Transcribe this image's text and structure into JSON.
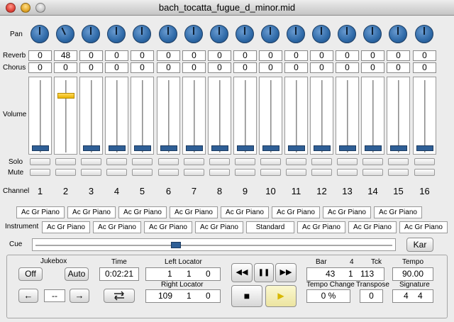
{
  "window": {
    "title": "bach_tocatta_fugue_d_minor.mid"
  },
  "labels": {
    "pan": "Pan",
    "reverb": "Reverb",
    "chorus": "Chorus",
    "volume": "Volume",
    "solo": "Solo",
    "mute": "Mute",
    "channel": "Channel",
    "instrument": "Instrument",
    "cue": "Cue"
  },
  "channels": [
    {
      "num": "1",
      "reverb": "0",
      "chorus": "0"
    },
    {
      "num": "2",
      "reverb": "48",
      "chorus": "0"
    },
    {
      "num": "3",
      "reverb": "0",
      "chorus": "0"
    },
    {
      "num": "4",
      "reverb": "0",
      "chorus": "0"
    },
    {
      "num": "5",
      "reverb": "0",
      "chorus": "0"
    },
    {
      "num": "6",
      "reverb": "0",
      "chorus": "0"
    },
    {
      "num": "7",
      "reverb": "0",
      "chorus": "0"
    },
    {
      "num": "8",
      "reverb": "0",
      "chorus": "0"
    },
    {
      "num": "9",
      "reverb": "0",
      "chorus": "0"
    },
    {
      "num": "10",
      "reverb": "0",
      "chorus": "0"
    },
    {
      "num": "11",
      "reverb": "0",
      "chorus": "0"
    },
    {
      "num": "12",
      "reverb": "0",
      "chorus": "0"
    },
    {
      "num": "13",
      "reverb": "0",
      "chorus": "0"
    },
    {
      "num": "14",
      "reverb": "0",
      "chorus": "0"
    },
    {
      "num": "15",
      "reverb": "0",
      "chorus": "0"
    },
    {
      "num": "16",
      "reverb": "0",
      "chorus": "0"
    }
  ],
  "instruments": {
    "row1": [
      "Ac Gr Piano",
      "Ac Gr Piano",
      "Ac Gr Piano",
      "Ac Gr Piano",
      "Ac Gr Piano",
      "Ac Gr Piano",
      "Ac Gr Piano",
      "Ac Gr Piano"
    ],
    "row2": [
      "Ac Gr Piano",
      "Ac Gr Piano",
      "Ac Gr Piano",
      "Ac Gr Piano",
      "Standard",
      "Ac Gr Piano",
      "Ac Gr Piano",
      "Ac Gr Piano"
    ]
  },
  "cue_button": "Kar",
  "jukebox": {
    "title": "Jukebox",
    "off": "Off",
    "auto": "Auto",
    "prev": "←",
    "next": "→",
    "current": "--"
  },
  "time": {
    "label": "Time",
    "value": "0:02:21"
  },
  "left_locator": {
    "label": "Left Locator",
    "bar": "1",
    "beat": "1",
    "tick": "0"
  },
  "right_locator": {
    "label": "Right Locator",
    "bar": "109",
    "beat": "1",
    "tick": "0"
  },
  "transport": {
    "rewind": "◀◀",
    "pause": "❚❚",
    "forward": "▶▶",
    "stop": "■",
    "play": "▶"
  },
  "position": {
    "bar_label": "Bar",
    "beat_label": "4",
    "tck_label": "Tck",
    "bar": "43",
    "beat": "1",
    "tick": "113"
  },
  "tempo": {
    "label": "Tempo",
    "value": "90.00"
  },
  "tempo_change": {
    "label": "Tempo Change",
    "value": "0 %"
  },
  "transpose": {
    "label": "Transpose",
    "value": "0"
  },
  "signature": {
    "label": "Signature",
    "num": "4",
    "den": "4"
  },
  "colors": {
    "knob": "#2f6aa8",
    "fader_thumb": "#2f5f96",
    "fader_active": "#f2c200",
    "play_highlight": "#f5f0b0"
  },
  "icons": {
    "loop": "loop-icon"
  }
}
